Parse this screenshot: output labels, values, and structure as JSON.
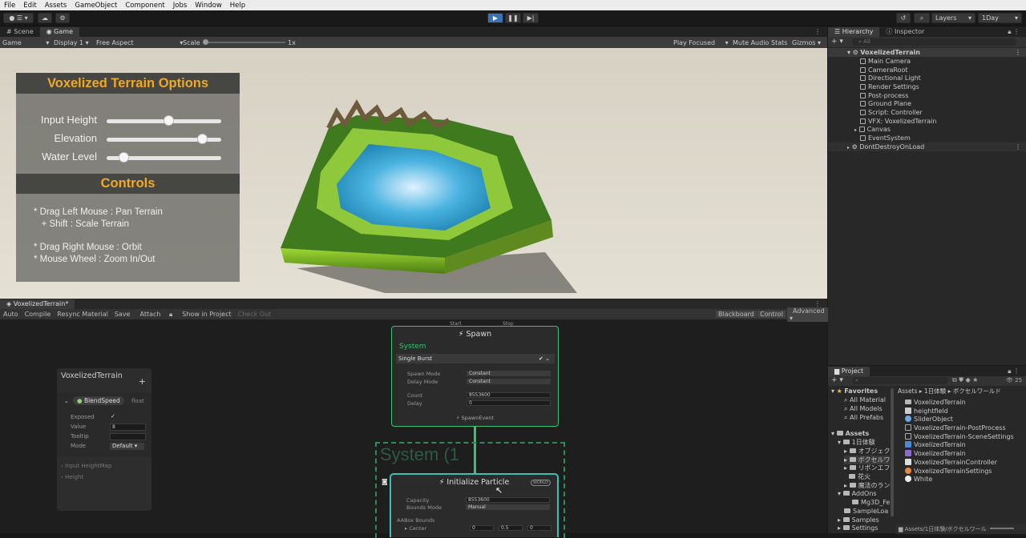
{
  "menu": [
    "File",
    "Edit",
    "Assets",
    "GameObject",
    "Component",
    "Jobs",
    "Window",
    "Help"
  ],
  "toolbar": {
    "layers": "Layers",
    "layout": "1Day"
  },
  "scene_tabs": {
    "scene": "Scene",
    "game": "Game"
  },
  "game_toolbar": {
    "mode": "Game",
    "display": "Display 1",
    "aspect": "Free Aspect",
    "scale_label": "Scale",
    "scale_value": "1x",
    "play_focused": "Play Focused",
    "mute": "Mute Audio",
    "stats": "Stats",
    "gizmos": "Gizmos"
  },
  "options_panel": {
    "title": "Voxelized Terrain Options",
    "sliders": [
      {
        "label": "Input Height",
        "value": 0.54
      },
      {
        "label": "Elevation",
        "value": 0.83
      },
      {
        "label": "Water Level",
        "value": 0.15
      }
    ],
    "controls_title": "Controls",
    "controls_1": "* Drag Left Mouse : Pan Terrain\n   + Shift : Scale Terrain",
    "controls_2": "* Drag Right Mouse : Orbit\n* Mouse Wheel : Zoom In/Out"
  },
  "vfx_graph": {
    "tab": "VoxelizedTerrain*",
    "toolbar": [
      "Auto",
      "Compile",
      "Resync Material",
      "Save",
      "Attach"
    ],
    "show_in_project": "Show in Project",
    "check_out": "Check Out",
    "right_buttons": [
      "Blackboard",
      "Control",
      "Advanced"
    ],
    "blackboard": {
      "title": "VoxelizedTerrain",
      "property": "BlendSpeed",
      "type": "float",
      "fields": [
        {
          "name": "Exposed",
          "value": "✓"
        },
        {
          "name": "Value",
          "value": "8"
        },
        {
          "name": "Tooltip",
          "value": ""
        },
        {
          "name": "Mode",
          "value": "Default"
        }
      ],
      "more": [
        "Input HeightMap",
        "Height"
      ]
    },
    "spawn": {
      "title": "Spawn",
      "ports": [
        "Start",
        "Stop"
      ],
      "section": "System",
      "block": "Single Burst",
      "rows": [
        {
          "name": "Spawn Mode",
          "value": "Constant"
        },
        {
          "name": "Delay Mode",
          "value": "Constant"
        },
        {
          "name": "Count",
          "value": "8553600"
        },
        {
          "name": "Delay",
          "value": "0"
        }
      ],
      "event": "SpawnEvent"
    },
    "system_label": "System (1",
    "init": {
      "title": "Initialize Particle",
      "badge": "WORLD",
      "rows": [
        {
          "name": "Capacity",
          "value": "8553600"
        },
        {
          "name": "Bounds Mode",
          "value": "Manual"
        }
      ],
      "bounds": "AABox Bounds",
      "center": "Center",
      "center_values": [
        "0",
        "0.5",
        "0"
      ]
    }
  },
  "hierarchy": {
    "tabs": [
      "Hierarchy",
      "Inspector"
    ],
    "search": "All",
    "root": "VoxelizedTerrain",
    "children": [
      "Main Camera",
      "CameraRoot",
      "Directional Light",
      "Render Settings",
      "Post-process",
      "Ground Plane",
      "Script: Controller",
      "VFX: VoxelizedTerrain",
      "Canvas",
      "EventSystem"
    ],
    "dont_destroy": "DontDestroyOnLoad"
  },
  "project": {
    "tab": "Project",
    "count": "25",
    "favorites": {
      "label": "Favorites",
      "items": [
        "All Material",
        "All Models",
        "All Prefabs"
      ]
    },
    "assets": {
      "label": "Assets",
      "tree": [
        "1日体験",
        "オブジェクト",
        "ボクセルワ",
        "リボンエフェ",
        "花火",
        "魔法のラン"
      ],
      "addons": "AddOns",
      "addons_child": "Mg3D_Fe",
      "others": [
        "SampleLoa",
        "Samples",
        "Settings"
      ]
    },
    "breadcrumb": [
      "Assets",
      "1日体験",
      "ボクセルワールド"
    ],
    "files": [
      "VoxelizedTerrain",
      "heightfield",
      "SliderObject",
      "VoxelizedTerrain-PostProcess",
      "VoxelizedTerrain-SceneSettings",
      "VoxelizedTerrain",
      "VoxelizedTerrain",
      "VoxelizedTerrainController",
      "VoxelizedTerrainSettings",
      "White"
    ],
    "footer": "Assets/1日体験/ボクセルワール"
  },
  "colors": {
    "accent": "#3a72b8",
    "options_title": "#f0a826",
    "vfx_green": "#38c172",
    "vfx_teal": "#3ebfb0"
  }
}
